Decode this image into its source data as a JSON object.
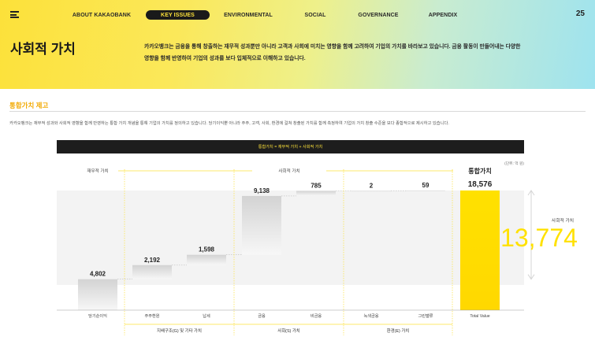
{
  "nav": {
    "items": [
      {
        "label": "ABOUT KAKAOBANK",
        "active": false
      },
      {
        "label": "KEY ISSUES",
        "active": true
      },
      {
        "label": "ENVIRONMENTAL",
        "active": false
      },
      {
        "label": "SOCIAL",
        "active": false
      },
      {
        "label": "GOVERNANCE",
        "active": false
      },
      {
        "label": "APPENDIX",
        "active": false
      }
    ],
    "page_number": "25"
  },
  "hero": {
    "title": "사회적 가치",
    "description": "카카오뱅크는 금융을 통해 창출하는 재무적 성과뿐만 아니라 고객과 사회에 미치는 영향을 함께 고려하여 기업의 가치를 바라보고 있습니다. 금융 활동이 만들어내는 다양한 영향을 함께 반영하여 기업의 성과를 보다 입체적으로 이해하고 있습니다."
  },
  "section": {
    "title": "통합가치 제고",
    "description": "카카오뱅크는 재무적 성과와 사회적 영향을 함께 반영하는 통합 가치 개념을 통해 기업의 가치를 정의하고 있습니다. 당기이익뿐 아니라 주주, 고객, 사회, 환경에 걸쳐 창출된 가치를 함께 측정하여 기업의 가치 창출 수준을 보다 종합적으로 제시하고 있습니다."
  },
  "chart_data": {
    "type": "bar",
    "subtype": "waterfall",
    "title": "통합가치 = 재무적 가치 + 사회적 가치",
    "unit": "(단위: 억 원)",
    "categories": [
      "당기순이익",
      "주주환원",
      "납세",
      "금융",
      "비금융",
      "녹색금융",
      "그린밸류",
      "Total Value"
    ],
    "values": [
      4802,
      2192,
      1598,
      9138,
      785,
      2,
      59,
      18576
    ],
    "value_labels": [
      "4,802",
      "2,192",
      "1,598",
      "9,138",
      "785",
      "2",
      "59",
      "18,576"
    ],
    "ylim": [
      0,
      18576
    ],
    "top_groups": [
      {
        "label": "재무적 가치",
        "from": 0,
        "to": 3
      },
      {
        "label": "사회적 가치",
        "from": 3,
        "to": 7
      }
    ],
    "bottom_groups": [
      {
        "label": "지배구조(G) 및 기타 가치",
        "from": 1,
        "to": 3
      },
      {
        "label": "사회(S) 가치",
        "from": 3,
        "to": 5
      },
      {
        "label": "환경(E) 가치",
        "from": 5,
        "to": 7
      }
    ],
    "total_label": "통합가치",
    "social_value_label": "사회적 가치",
    "social_value": "13,774",
    "colors": {
      "accent": "#fce13a",
      "total": "#ffe100",
      "bar": "#d6d6d6",
      "band": "#f3f3f3",
      "text": "#222222"
    }
  }
}
